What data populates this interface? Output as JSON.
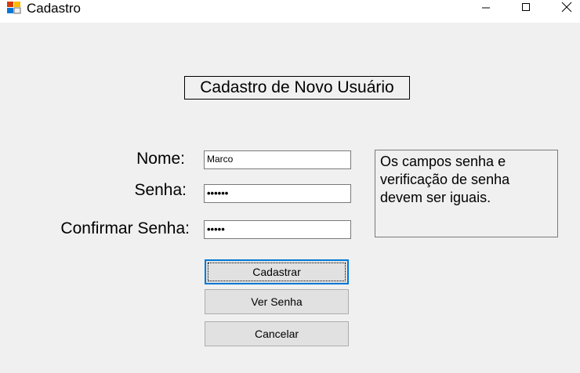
{
  "window": {
    "title": "Cadastro"
  },
  "form": {
    "heading": "Cadastro de Novo Usuário",
    "nome_label": "Nome:",
    "senha_label": "Senha:",
    "confirmar_label": "Confirmar Senha:",
    "nome_value": "Marco",
    "senha_value": "••••••",
    "confirmar_value": "•••••",
    "info_text": "Os campos senha e verificação de senha devem ser iguais."
  },
  "buttons": {
    "cadastrar": "Cadastrar",
    "ver_senha": "Ver Senha",
    "cancelar": "Cancelar"
  },
  "icons": {
    "app": "windows-form-icon",
    "minimize": "minimize-icon",
    "maximize": "maximize-icon",
    "close": "close-icon"
  },
  "colors": {
    "window_bg": "#f0f0f0",
    "titlebar_bg": "#ffffff",
    "button_bg": "#e1e1e1",
    "focus_border": "#0078d7"
  }
}
